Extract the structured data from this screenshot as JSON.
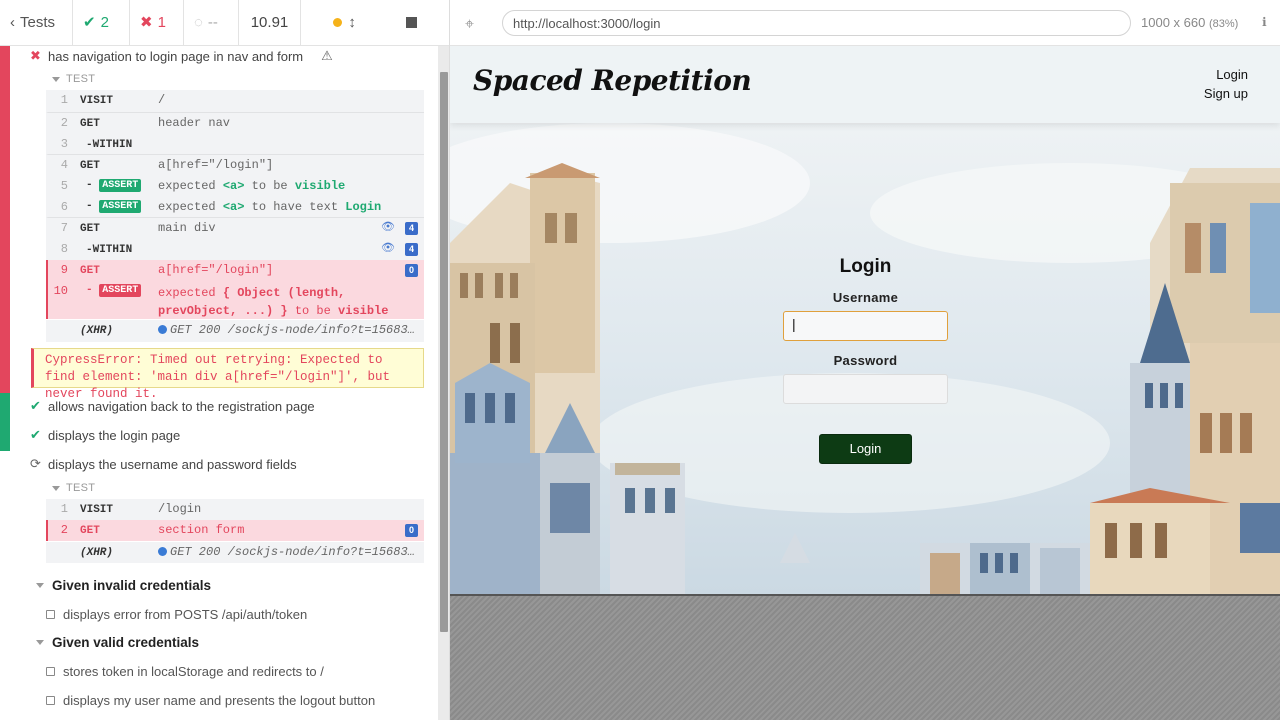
{
  "reporter": {
    "stats": {
      "back_label": "Tests",
      "passed": "2",
      "failed": "1",
      "pending": "--",
      "duration": "10.91"
    },
    "tests": {
      "t1": {
        "title": "has navigation to login page in nav and form",
        "hook": "TEST",
        "commands": [
          {
            "num": "1",
            "name": "VISIT",
            "msg": "/"
          },
          {
            "num": "2",
            "name": "GET",
            "msg": "header nav"
          },
          {
            "num": "3",
            "name": "-WITHIN",
            "msg": ""
          },
          {
            "num": "4",
            "name": "GET",
            "msg": "a[href=\"/login\"]"
          },
          {
            "num": "5",
            "name": "ASSERT",
            "msg_pre": "expected",
            "msg_el": "<a>",
            "msg_mid": "to be",
            "msg_val": "visible"
          },
          {
            "num": "6",
            "name": "ASSERT",
            "msg_pre": "expected",
            "msg_el": "<a>",
            "msg_mid": "to have text",
            "msg_val": "Login"
          },
          {
            "num": "7",
            "name": "GET",
            "msg": "main div",
            "count": "4"
          },
          {
            "num": "8",
            "name": "-WITHIN",
            "msg": "",
            "count": "4"
          },
          {
            "num": "9",
            "name": "GET",
            "msg": "a[href=\"/login\"]",
            "count": "0"
          },
          {
            "num": "10",
            "name": "ASSERT",
            "msg_pre": "expected",
            "msg_obj1": "{ Object (length,",
            "msg_obj2": "prevObject, ...) }",
            "msg_mid": "to be",
            "msg_val": "visible"
          }
        ],
        "xhr_label": "(XHR)",
        "xhr_msg": "GET 200 /sockjs-node/info?t=15683…",
        "error": "CypressError: Timed out retrying: Expected to find element: 'main div a[href=\"/login\"]', but never found it."
      },
      "t2": {
        "title": "allows navigation back to the registration page"
      },
      "t3": {
        "title": "displays the login page"
      },
      "t4": {
        "title": "displays the username and password fields",
        "hook": "TEST",
        "commands": [
          {
            "num": "1",
            "name": "VISIT",
            "msg": "/login"
          },
          {
            "num": "2",
            "name": "GET",
            "msg": "section form",
            "count": "0"
          }
        ],
        "xhr_label": "(XHR)",
        "xhr_msg": "GET 200 /sockjs-node/info?t=15683…"
      }
    },
    "suites": [
      {
        "title": "Given invalid credentials",
        "tests": [
          "displays error from POSTS /api/auth/token"
        ]
      },
      {
        "title": "Given valid credentials",
        "tests": [
          "stores token in localStorage and redirects to /",
          "displays my user name and presents the logout button"
        ]
      }
    ]
  },
  "aut": {
    "url": "http://localhost:3000/login",
    "viewport": "1000 x 660",
    "zoom": "(83%)",
    "app": {
      "brand": "Spaced Repetition",
      "nav": [
        "Login",
        "Sign up"
      ],
      "form": {
        "heading": "Login",
        "username_label": "Username",
        "password_label": "Password",
        "username_value": "|",
        "submit": "Login"
      }
    }
  },
  "colors": {
    "pass": "#1fa971",
    "fail": "#e3465d",
    "login_button": "#0d3b14"
  }
}
